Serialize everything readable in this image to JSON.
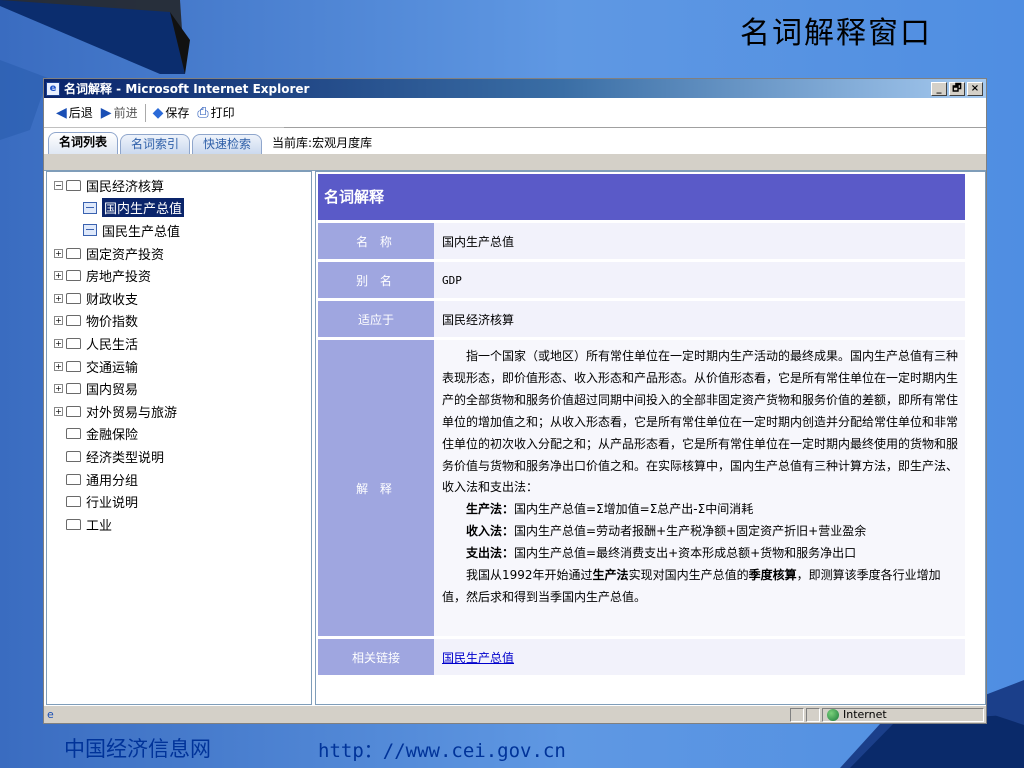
{
  "slide": {
    "title": "名词解释窗口",
    "footer_site": "中国经济信息网",
    "footer_url": "http：//www.cei.gov.cn"
  },
  "window": {
    "title": "名词解释 - Microsoft Internet Explorer",
    "controls": {
      "minimize": "_",
      "maximize": "🗗",
      "close": "×"
    }
  },
  "toolbar": {
    "back_label": "后退",
    "forward_label": "前进",
    "save_label": "保存",
    "print_label": "打印"
  },
  "tabs": [
    {
      "label": "名词列表",
      "active": true
    },
    {
      "label": "名词索引",
      "active": false
    },
    {
      "label": "快速检索",
      "active": false
    }
  ],
  "current_library": "当前库:宏观月度库",
  "tree": [
    {
      "label": "国民经济核算",
      "expanded": true,
      "children": [
        {
          "label": "国内生产总值",
          "selected": true
        },
        {
          "label": "国民生产总值",
          "selected": false
        }
      ]
    },
    {
      "label": "固定资产投资",
      "expandable": true
    },
    {
      "label": "房地产投资",
      "expandable": true
    },
    {
      "label": "财政收支",
      "expandable": true
    },
    {
      "label": "物价指数",
      "expandable": true
    },
    {
      "label": "人民生活",
      "expandable": true
    },
    {
      "label": "交通运输",
      "expandable": true
    },
    {
      "label": "国内贸易",
      "expandable": true
    },
    {
      "label": "对外贸易与旅游",
      "expandable": true
    },
    {
      "label": "金融保险",
      "expandable": false
    },
    {
      "label": "经济类型说明",
      "expandable": false
    },
    {
      "label": "通用分组",
      "expandable": false
    },
    {
      "label": "行业说明",
      "expandable": false
    },
    {
      "label": "工业",
      "expandable": false
    }
  ],
  "detail": {
    "header": "名词解释",
    "name_label": "名 称",
    "name_value": "国内生产总值",
    "alias_label": "别 名",
    "alias_value": "GDP",
    "applies_label": "适应于",
    "applies_value": "国民经济核算",
    "explain_label": "解 释",
    "explain_p1": "指一个国家（或地区）所有常住单位在一定时期内生产活动的最终成果。国内生产总值有三种表现形态，即价值形态、收入形态和产品形态。从价值形态看，它是所有常住单位在一定时期内生产的全部货物和服务价值超过同期中间投入的全部非固定资产货物和服务价值的差额，即所有常住单位的增加值之和；从收入形态看，它是所有常住单位在一定时期内创造并分配给常住单位和非常住单位的初次收入分配之和；从产品形态看，它是所有常住单位在一定时期内最终使用的货物和服务价值与货物和服务净出口价值之和。在实际核算中，国内生产总值有三种计算方法，即生产法、收入法和支出法：",
    "method1_name": "生产法：",
    "method1_text": "国内生产总值=Σ增加值=Σ总产出-Σ中间消耗",
    "method2_name": "收入法：",
    "method2_text": "国内生产总值=劳动者报酬+生产税净额+固定资产折旧+营业盈余",
    "method3_name": "支出法：",
    "method3_text": "国内生产总值=最终消费支出+资本形成总额+货物和服务净出口",
    "p_last_a": "我国从1992年开始通过",
    "p_last_b": "生产法",
    "p_last_c": "实现对国内生产总值的",
    "p_last_d": "季度核算",
    "p_last_e": "，即测算该季度各行业增加值，然后求和得到当季国内生产总值。",
    "related_label": "相关链接",
    "related_value": "国民生产总值"
  },
  "statusbar": {
    "zone": "Internet"
  },
  "icons": {
    "back": "back-arrow-icon",
    "forward": "forward-arrow-icon",
    "save": "save-icon",
    "print": "printer-icon",
    "folder": "folder-icon",
    "document": "document-icon",
    "globe": "internet-globe-icon"
  }
}
